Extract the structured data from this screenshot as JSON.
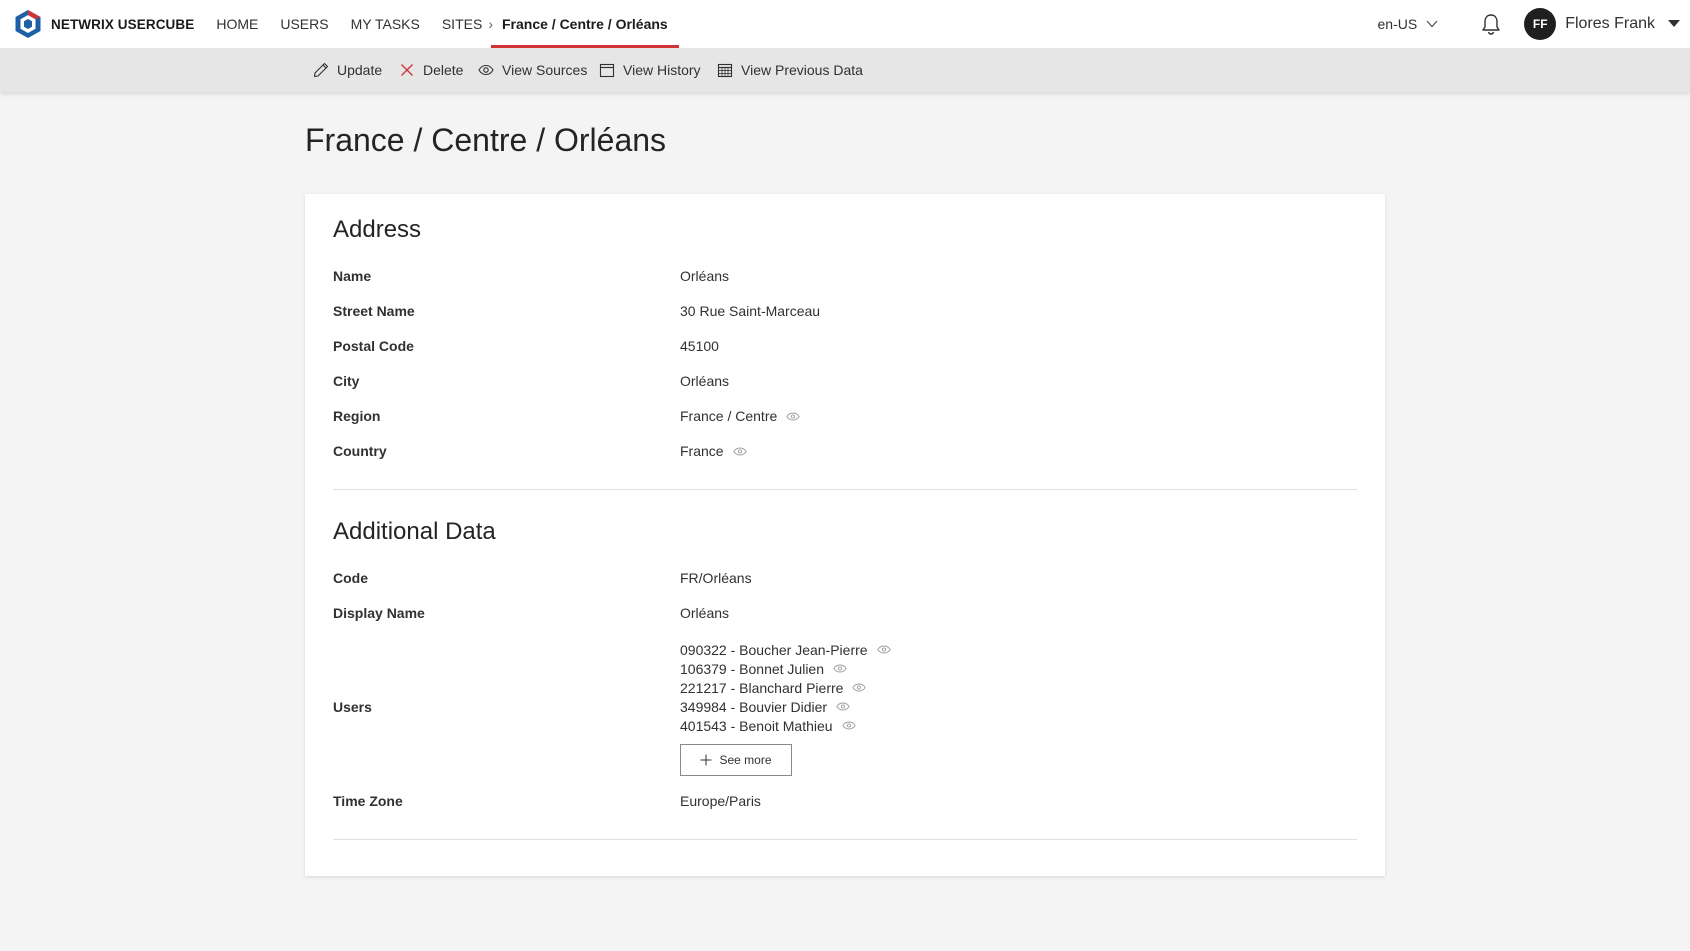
{
  "brand": {
    "name": "NETWRIX USERCUBE"
  },
  "nav": {
    "items": [
      {
        "label": "HOME"
      },
      {
        "label": "USERS"
      },
      {
        "label": "MY TASKS"
      },
      {
        "label": "SITES"
      }
    ],
    "active_breadcrumb": "France / Centre / Orléans"
  },
  "header": {
    "language": "en-US",
    "user_initials": "FF",
    "user_name": "Flores Frank"
  },
  "toolbar": {
    "update": "Update",
    "delete": "Delete",
    "view_sources": "View Sources",
    "view_history": "View History",
    "view_previous_data": "View Previous Data"
  },
  "page": {
    "title": "France / Centre / Orléans"
  },
  "address": {
    "title": "Address",
    "fields": [
      {
        "label": "Name",
        "value": "Orléans"
      },
      {
        "label": "Street Name",
        "value": "30 Rue Saint-Marceau"
      },
      {
        "label": "Postal Code",
        "value": "45100"
      },
      {
        "label": "City",
        "value": "Orléans"
      },
      {
        "label": "Region",
        "value": "France / Centre"
      },
      {
        "label": "Country",
        "value": "France"
      }
    ]
  },
  "additional": {
    "title": "Additional Data",
    "code_label": "Code",
    "code_value": "FR/Orléans",
    "display_name_label": "Display Name",
    "display_name_value": "Orléans",
    "users_label": "Users",
    "users": [
      "090322 - Boucher Jean-Pierre",
      "106379 - Bonnet Julien",
      "221217 - Blanchard Pierre",
      "349984 - Bouvier Didier",
      "401543 - Benoit Mathieu"
    ],
    "see_more": "See more",
    "time_zone_label": "Time Zone",
    "time_zone_value": "Europe/Paris"
  },
  "colors": {
    "accent": "#d13438",
    "brand_blue": "#1f5fa8",
    "avatar_bg": "#1f1f1f"
  },
  "icons": {
    "logo": "usercube-logo-icon",
    "language": "chevron-down-icon",
    "notifications": "bell-icon",
    "account_menu": "caret-down-icon",
    "update": "pencil-icon",
    "delete": "close-icon",
    "view_sources": "eye-icon",
    "view_history": "calendar-icon",
    "view_previous_data": "calendar-grid-icon",
    "see_more": "plus-icon",
    "navigate": "eye-icon"
  }
}
